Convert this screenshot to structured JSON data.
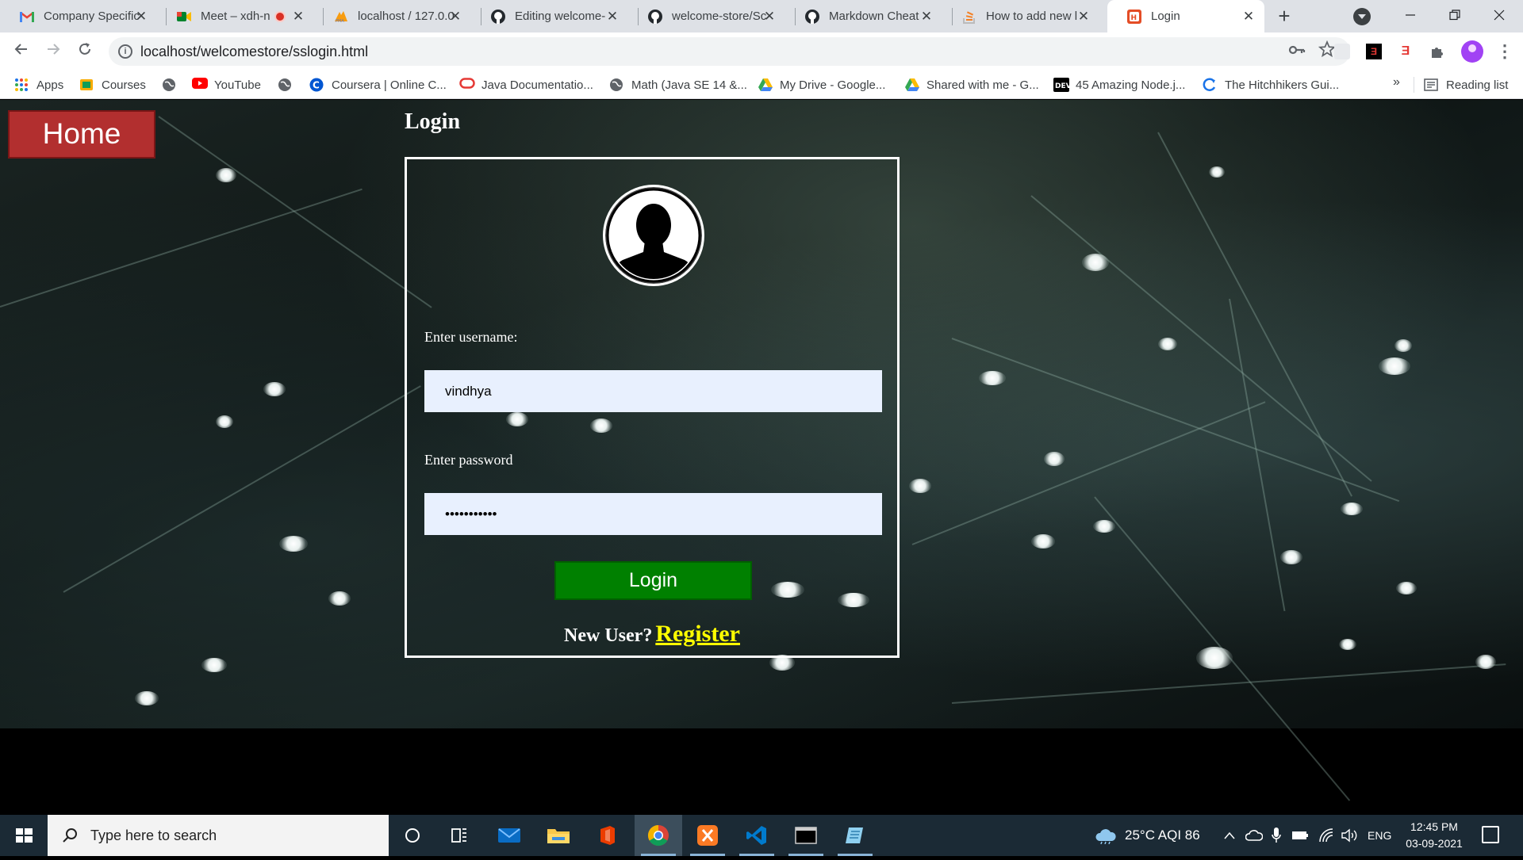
{
  "browser": {
    "tabs": [
      {
        "title": "Company Specific",
        "icon": "gmail-icon"
      },
      {
        "title": "Meet – xdh-n",
        "icon": "meet-icon",
        "recording": true
      },
      {
        "title": "localhost / 127.0.0",
        "icon": "phpmyadmin-icon"
      },
      {
        "title": "Editing welcome-",
        "icon": "github-icon"
      },
      {
        "title": "welcome-store/Sc",
        "icon": "github-icon"
      },
      {
        "title": "Markdown Cheat",
        "icon": "github-icon"
      },
      {
        "title": "How to add new l",
        "icon": "stackoverflow-icon"
      },
      {
        "title": "Login",
        "icon": "html5-icon",
        "active": true
      }
    ],
    "new_tab": "+",
    "close_glyph": "✕",
    "url": "localhost/welcomestore/sslogin.html",
    "bookmarks": [
      {
        "label": "Apps",
        "icon": "apps-grid-icon"
      },
      {
        "label": "Courses",
        "icon": "courses-icon"
      },
      {
        "label": "",
        "icon": "globe-icon"
      },
      {
        "label": "YouTube",
        "icon": "youtube-icon"
      },
      {
        "label": "",
        "icon": "globe-icon"
      },
      {
        "label": "Coursera | Online C...",
        "icon": "coursera-icon"
      },
      {
        "label": "Java Documentatio...",
        "icon": "oracle-icon"
      },
      {
        "label": "Math (Java SE 14 &...",
        "icon": "globe-icon"
      },
      {
        "label": "My Drive - Google...",
        "icon": "drive-icon"
      },
      {
        "label": "Shared with me - G...",
        "icon": "drive-icon"
      },
      {
        "label": "45 Amazing Node.j...",
        "icon": "dev-icon"
      },
      {
        "label": "The Hitchhikers Gui...",
        "icon": "hitchhikers-icon"
      }
    ],
    "bookmarks_more": "»",
    "reading_list": "Reading list"
  },
  "page": {
    "home_button": "Home",
    "heading": "Login",
    "username_label": "Enter username:",
    "username_value": "vindhya",
    "password_label": "Enter password",
    "password_value": "•••••••••••",
    "login_button": "Login",
    "new_user_text": "New User?",
    "register_link": "Register"
  },
  "taskbar": {
    "search_placeholder": "Type here to search",
    "weather": "25°C  AQI 86",
    "language": "ENG",
    "time": "12:45 PM",
    "date": "03-09-2021"
  },
  "colors": {
    "home_button_bg": "#b22f2f",
    "login_button_bg": "#008000",
    "register_link": "#ffff00",
    "input_bg": "#e8f0fe"
  }
}
